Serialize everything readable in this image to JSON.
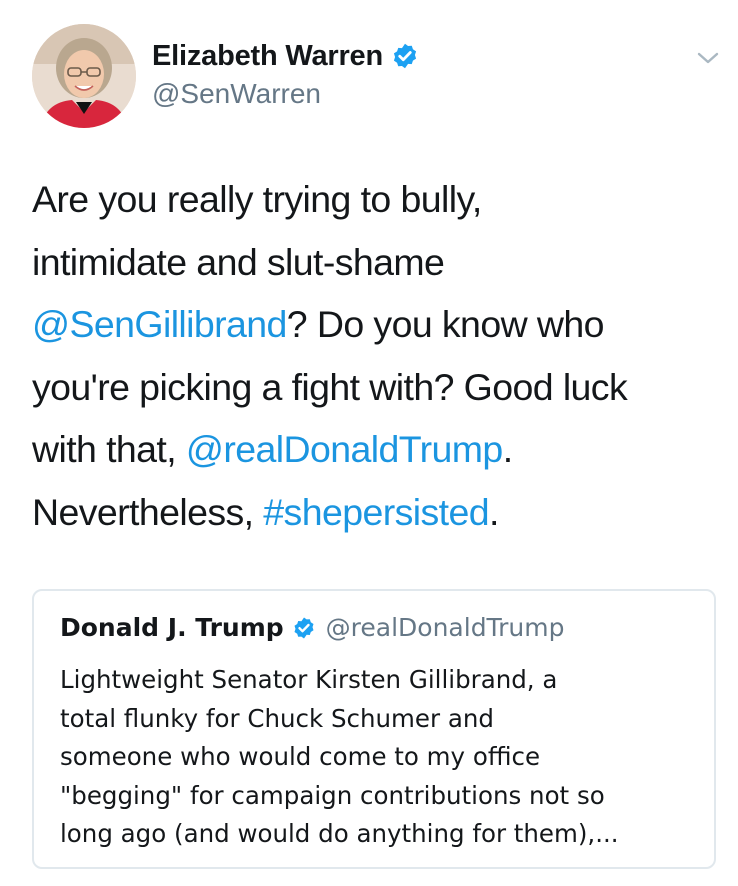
{
  "tweet": {
    "author": {
      "display_name": "Elizabeth Warren",
      "handle": "@SenWarren",
      "verified": true,
      "avatar_icon": "avatar-photo"
    },
    "menu_icon": "chevron-down-icon",
    "text_lines": [
      [
        {
          "text": "Are you really trying to bully,",
          "link": false
        }
      ],
      [
        {
          "text": "intimidate and slut-shame",
          "link": false
        }
      ],
      [
        {
          "text": "@SenGillibrand",
          "link": true
        },
        {
          "text": "? Do you know who",
          "link": false
        }
      ],
      [
        {
          "text": "you're picking a fight with? Good luck",
          "link": false
        }
      ],
      [
        {
          "text": "with that, ",
          "link": false
        },
        {
          "text": "@realDonaldTrump",
          "link": true
        },
        {
          "text": ".",
          "link": false
        }
      ],
      [
        {
          "text": "Nevertheless, ",
          "link": false
        },
        {
          "text": "#shepersisted",
          "link": true
        },
        {
          "text": ".",
          "link": false
        }
      ]
    ]
  },
  "quoted_tweet": {
    "display_name": "Donald J. Trump",
    "handle": "@realDonaldTrump",
    "verified": true,
    "text_lines": [
      "Lightweight Senator Kirsten Gillibrand, a",
      "total flunky for Chuck Schumer and",
      "someone who would come to my office",
      "\"begging\" for campaign contributions not so",
      "long ago (and would do anything for them),..."
    ]
  },
  "colors": {
    "link": "#1b95e0",
    "verified": "#1da1f2",
    "text": "#14171a",
    "secondary_text": "#657786",
    "border": "#e1e8ed"
  }
}
